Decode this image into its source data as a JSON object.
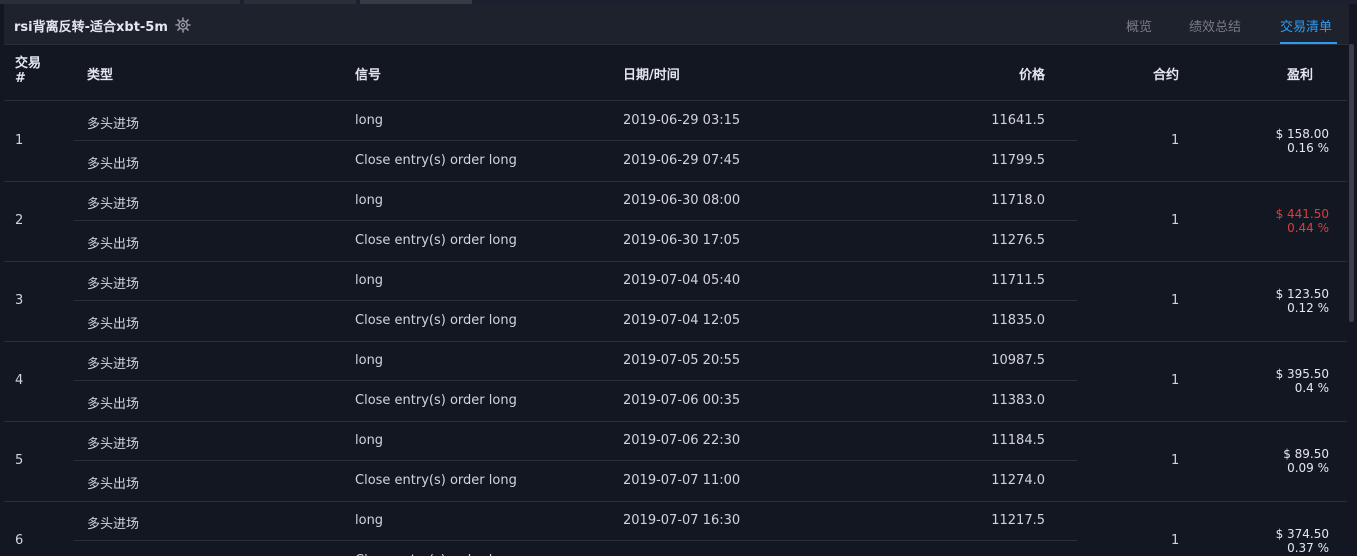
{
  "header": {
    "title": "rsi背离反转-适合xbt-5m",
    "tabs": [
      {
        "label": "概览",
        "active": false
      },
      {
        "label": "绩效总结",
        "active": false
      },
      {
        "label": "交易清单",
        "active": true
      }
    ],
    "settings_icon": "gear-icon"
  },
  "table": {
    "columns": {
      "trade_no": "交易 #",
      "type": "类型",
      "signal": "信号",
      "datetime": "日期/时间",
      "price": "价格",
      "contracts": "合约",
      "pnl": "盈利"
    },
    "trades": [
      {
        "no": "1",
        "contracts": "1",
        "pnl": "$ 158.00",
        "pnl_pct": "0.16 %",
        "loss": false,
        "entry": {
          "type": "多头进场",
          "signal": "long",
          "datetime": "2019-06-29 03:15",
          "price": "11641.5"
        },
        "exit": {
          "type": "多头出场",
          "signal": "Close entry(s) order long",
          "datetime": "2019-06-29 07:45",
          "price": "11799.5"
        }
      },
      {
        "no": "2",
        "contracts": "1",
        "pnl": "$ 441.50",
        "pnl_pct": "0.44 %",
        "loss": true,
        "entry": {
          "type": "多头进场",
          "signal": "long",
          "datetime": "2019-06-30 08:00",
          "price": "11718.0"
        },
        "exit": {
          "type": "多头出场",
          "signal": "Close entry(s) order long",
          "datetime": "2019-06-30 17:05",
          "price": "11276.5"
        }
      },
      {
        "no": "3",
        "contracts": "1",
        "pnl": "$ 123.50",
        "pnl_pct": "0.12 %",
        "loss": false,
        "entry": {
          "type": "多头进场",
          "signal": "long",
          "datetime": "2019-07-04 05:40",
          "price": "11711.5"
        },
        "exit": {
          "type": "多头出场",
          "signal": "Close entry(s) order long",
          "datetime": "2019-07-04 12:05",
          "price": "11835.0"
        }
      },
      {
        "no": "4",
        "contracts": "1",
        "pnl": "$ 395.50",
        "pnl_pct": "0.4 %",
        "loss": false,
        "entry": {
          "type": "多头进场",
          "signal": "long",
          "datetime": "2019-07-05 20:55",
          "price": "10987.5"
        },
        "exit": {
          "type": "多头出场",
          "signal": "Close entry(s) order long",
          "datetime": "2019-07-06 00:35",
          "price": "11383.0"
        }
      },
      {
        "no": "5",
        "contracts": "1",
        "pnl": "$ 89.50",
        "pnl_pct": "0.09 %",
        "loss": false,
        "entry": {
          "type": "多头进场",
          "signal": "long",
          "datetime": "2019-07-06 22:30",
          "price": "11184.5"
        },
        "exit": {
          "type": "多头出场",
          "signal": "Close entry(s) order long",
          "datetime": "2019-07-07 11:00",
          "price": "11274.0"
        }
      },
      {
        "no": "6",
        "contracts": "1",
        "pnl": "$ 374.50",
        "pnl_pct": "0.37 %",
        "loss": false,
        "entry": {
          "type": "多头进场",
          "signal": "long",
          "datetime": "2019-07-07 16:30",
          "price": "11217.5"
        },
        "exit": {
          "type": "多头出场",
          "signal": "Close entry(s) order long",
          "datetime": "",
          "price": ""
        }
      }
    ]
  },
  "colors": {
    "background": "#131722",
    "header_bg": "#1e222d",
    "accent": "#2e9cf2",
    "loss": "#e03a3a",
    "text": "#d1d4dc",
    "muted": "#787b86"
  }
}
